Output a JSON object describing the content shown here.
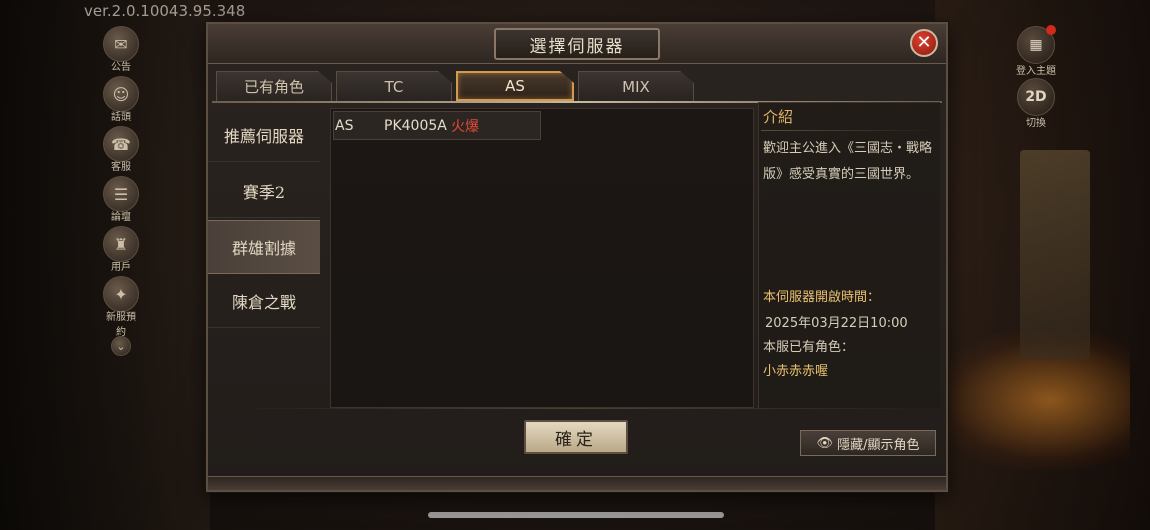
{
  "app": {
    "version": "ver.2.0.10043.95.348"
  },
  "left_icons": [
    {
      "icon": "announcement-icon",
      "label": "公告"
    },
    {
      "icon": "discussion-icon",
      "label": "話頭"
    },
    {
      "icon": "customer-service-icon",
      "label": "客服"
    },
    {
      "icon": "forum-icon",
      "label": "論壇"
    },
    {
      "icon": "user-icon",
      "label": "用戶"
    },
    {
      "icon": "new-server-icon",
      "label": "新服預約"
    }
  ],
  "right_icons": [
    {
      "icon": "theme-icon",
      "label": "登入主題"
    },
    {
      "icon": "view-2d-3d-icon",
      "label": "切換",
      "text": "2D"
    }
  ],
  "dialog": {
    "title": "選擇伺服器",
    "tabs": [
      "已有角色",
      "TC",
      "AS",
      "MIX"
    ],
    "active_tab": "AS",
    "categories": [
      "推薦伺服器",
      "賽季2",
      "群雄割據",
      "陳倉之戰"
    ],
    "active_category": "群雄割據",
    "servers": [
      {
        "region": "AS",
        "name": "PK4005A",
        "status": "火爆",
        "status_color": "#e04a3a"
      }
    ],
    "info": {
      "heading": "介紹",
      "description": "歡迎主公進入《三國志・戰略版》感受真實的三國世界。",
      "open_time_label": "本伺服器開啟時間：",
      "open_time": "2025年03月22日10:00",
      "role_label": "本服已有角色：",
      "role_name": "小赤赤赤喔"
    },
    "confirm_label": "確定",
    "toggle_label": "隱藏/顯示角色"
  },
  "colors": {
    "accent_gold": "#e0b565",
    "hot_red": "#e04a3a",
    "tab_active_border": "#d09a50"
  }
}
